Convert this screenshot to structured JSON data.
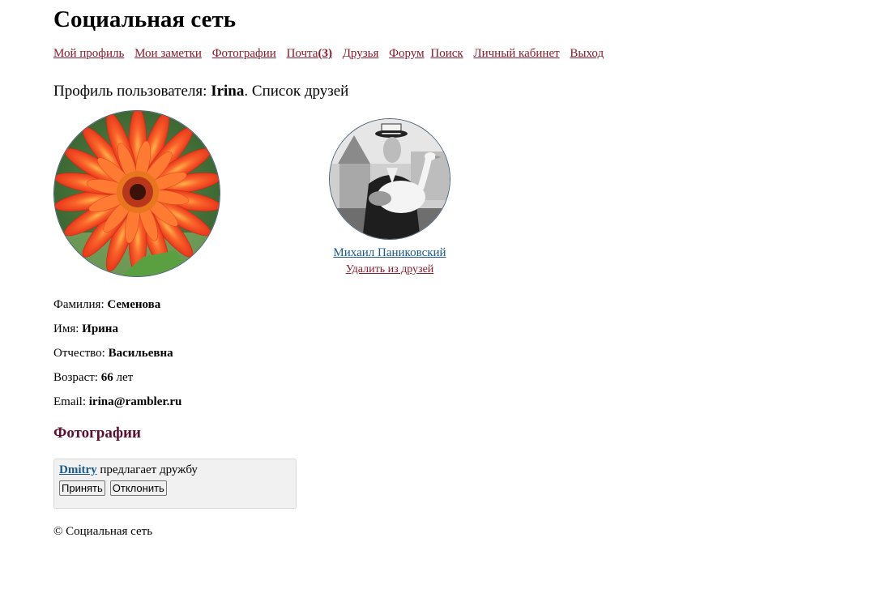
{
  "site": {
    "title": "Социальная сеть"
  },
  "nav": {
    "items": [
      {
        "label": "Мой профиль"
      },
      {
        "label": "Мои заметки"
      },
      {
        "label": "Фотографии"
      },
      {
        "label": "Почта",
        "count": "(3)"
      },
      {
        "label": "Друзья"
      },
      {
        "label": "Форум"
      },
      {
        "label": "Поиск"
      },
      {
        "label": "Личный кабинет"
      },
      {
        "label": "Выход"
      }
    ]
  },
  "profile": {
    "heading_prefix": "Профиль пользователя: ",
    "username": "Irina",
    "heading_suffix": ". Список друзей"
  },
  "friends": [
    {
      "name": "Михаил Паниковский",
      "remove_label": "Удалить из друзей"
    }
  ],
  "info": {
    "surname_label": "Фамилия: ",
    "surname": "Семенова",
    "name_label": "Имя: ",
    "name": "Ирина",
    "patronymic_label": "Отчество: ",
    "patronymic": "Васильевна",
    "age_label": "Возраст: ",
    "age": "66",
    "age_unit": " лет",
    "email_label": "Email: ",
    "email": "irina@rambler.ru"
  },
  "photos": {
    "heading": "Фотографии"
  },
  "request": {
    "user": "Dmitry",
    "text": " предлагает дружбу",
    "accept_label": "Принять",
    "decline_label": "Отклонить"
  },
  "footer": {
    "text": "© Социальная сеть"
  },
  "colors": {
    "nav_link": "#8b1a2a",
    "friend_link": "#1c5a8c",
    "photos_heading": "#5a1030"
  }
}
